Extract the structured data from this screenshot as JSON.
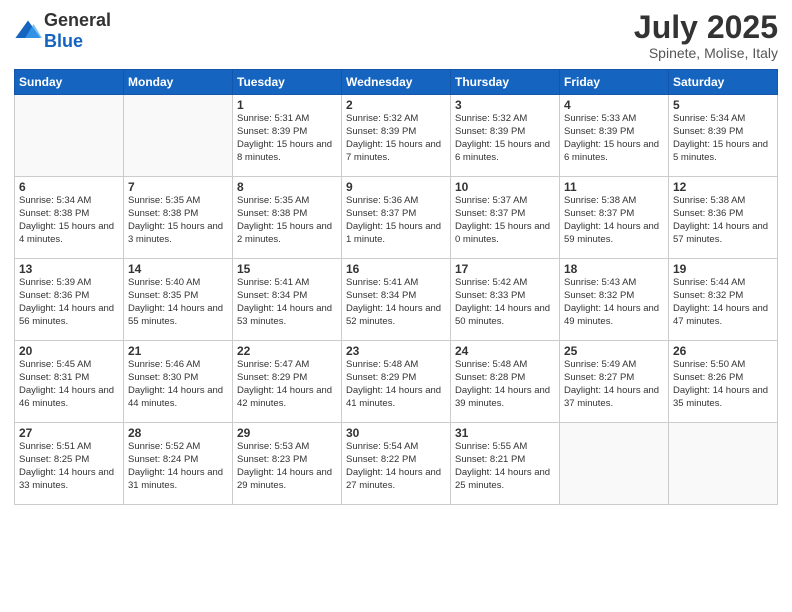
{
  "logo": {
    "general": "General",
    "blue": "Blue"
  },
  "title": "July 2025",
  "subtitle": "Spinete, Molise, Italy",
  "weekdays": [
    "Sunday",
    "Monday",
    "Tuesday",
    "Wednesday",
    "Thursday",
    "Friday",
    "Saturday"
  ],
  "weeks": [
    [
      {
        "day": "",
        "detail": ""
      },
      {
        "day": "",
        "detail": ""
      },
      {
        "day": "1",
        "detail": "Sunrise: 5:31 AM\nSunset: 8:39 PM\nDaylight: 15 hours and 8 minutes."
      },
      {
        "day": "2",
        "detail": "Sunrise: 5:32 AM\nSunset: 8:39 PM\nDaylight: 15 hours and 7 minutes."
      },
      {
        "day": "3",
        "detail": "Sunrise: 5:32 AM\nSunset: 8:39 PM\nDaylight: 15 hours and 6 minutes."
      },
      {
        "day": "4",
        "detail": "Sunrise: 5:33 AM\nSunset: 8:39 PM\nDaylight: 15 hours and 6 minutes."
      },
      {
        "day": "5",
        "detail": "Sunrise: 5:34 AM\nSunset: 8:39 PM\nDaylight: 15 hours and 5 minutes."
      }
    ],
    [
      {
        "day": "6",
        "detail": "Sunrise: 5:34 AM\nSunset: 8:38 PM\nDaylight: 15 hours and 4 minutes."
      },
      {
        "day": "7",
        "detail": "Sunrise: 5:35 AM\nSunset: 8:38 PM\nDaylight: 15 hours and 3 minutes."
      },
      {
        "day": "8",
        "detail": "Sunrise: 5:35 AM\nSunset: 8:38 PM\nDaylight: 15 hours and 2 minutes."
      },
      {
        "day": "9",
        "detail": "Sunrise: 5:36 AM\nSunset: 8:37 PM\nDaylight: 15 hours and 1 minute."
      },
      {
        "day": "10",
        "detail": "Sunrise: 5:37 AM\nSunset: 8:37 PM\nDaylight: 15 hours and 0 minutes."
      },
      {
        "day": "11",
        "detail": "Sunrise: 5:38 AM\nSunset: 8:37 PM\nDaylight: 14 hours and 59 minutes."
      },
      {
        "day": "12",
        "detail": "Sunrise: 5:38 AM\nSunset: 8:36 PM\nDaylight: 14 hours and 57 minutes."
      }
    ],
    [
      {
        "day": "13",
        "detail": "Sunrise: 5:39 AM\nSunset: 8:36 PM\nDaylight: 14 hours and 56 minutes."
      },
      {
        "day": "14",
        "detail": "Sunrise: 5:40 AM\nSunset: 8:35 PM\nDaylight: 14 hours and 55 minutes."
      },
      {
        "day": "15",
        "detail": "Sunrise: 5:41 AM\nSunset: 8:34 PM\nDaylight: 14 hours and 53 minutes."
      },
      {
        "day": "16",
        "detail": "Sunrise: 5:41 AM\nSunset: 8:34 PM\nDaylight: 14 hours and 52 minutes."
      },
      {
        "day": "17",
        "detail": "Sunrise: 5:42 AM\nSunset: 8:33 PM\nDaylight: 14 hours and 50 minutes."
      },
      {
        "day": "18",
        "detail": "Sunrise: 5:43 AM\nSunset: 8:32 PM\nDaylight: 14 hours and 49 minutes."
      },
      {
        "day": "19",
        "detail": "Sunrise: 5:44 AM\nSunset: 8:32 PM\nDaylight: 14 hours and 47 minutes."
      }
    ],
    [
      {
        "day": "20",
        "detail": "Sunrise: 5:45 AM\nSunset: 8:31 PM\nDaylight: 14 hours and 46 minutes."
      },
      {
        "day": "21",
        "detail": "Sunrise: 5:46 AM\nSunset: 8:30 PM\nDaylight: 14 hours and 44 minutes."
      },
      {
        "day": "22",
        "detail": "Sunrise: 5:47 AM\nSunset: 8:29 PM\nDaylight: 14 hours and 42 minutes."
      },
      {
        "day": "23",
        "detail": "Sunrise: 5:48 AM\nSunset: 8:29 PM\nDaylight: 14 hours and 41 minutes."
      },
      {
        "day": "24",
        "detail": "Sunrise: 5:48 AM\nSunset: 8:28 PM\nDaylight: 14 hours and 39 minutes."
      },
      {
        "day": "25",
        "detail": "Sunrise: 5:49 AM\nSunset: 8:27 PM\nDaylight: 14 hours and 37 minutes."
      },
      {
        "day": "26",
        "detail": "Sunrise: 5:50 AM\nSunset: 8:26 PM\nDaylight: 14 hours and 35 minutes."
      }
    ],
    [
      {
        "day": "27",
        "detail": "Sunrise: 5:51 AM\nSunset: 8:25 PM\nDaylight: 14 hours and 33 minutes."
      },
      {
        "day": "28",
        "detail": "Sunrise: 5:52 AM\nSunset: 8:24 PM\nDaylight: 14 hours and 31 minutes."
      },
      {
        "day": "29",
        "detail": "Sunrise: 5:53 AM\nSunset: 8:23 PM\nDaylight: 14 hours and 29 minutes."
      },
      {
        "day": "30",
        "detail": "Sunrise: 5:54 AM\nSunset: 8:22 PM\nDaylight: 14 hours and 27 minutes."
      },
      {
        "day": "31",
        "detail": "Sunrise: 5:55 AM\nSunset: 8:21 PM\nDaylight: 14 hours and 25 minutes."
      },
      {
        "day": "",
        "detail": ""
      },
      {
        "day": "",
        "detail": ""
      }
    ]
  ]
}
